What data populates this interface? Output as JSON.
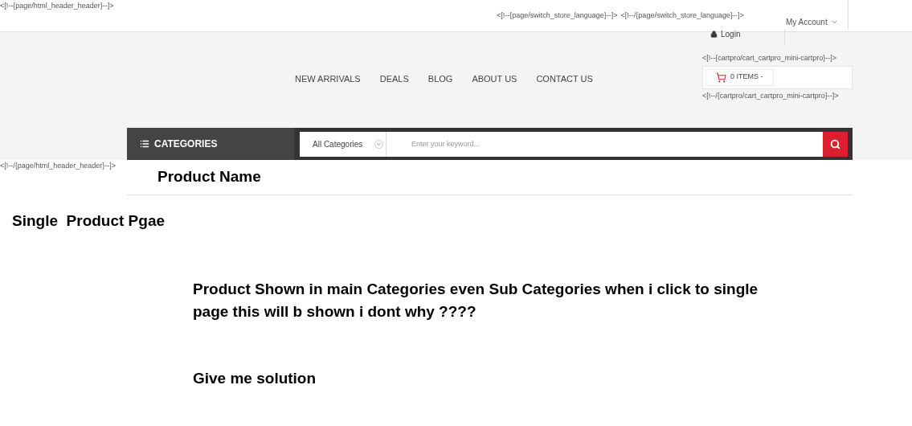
{
  "header_comment_open": "<[!--{page/html_header_header}--]>",
  "language_comments": [
    "<[!--{page/switch_store_language}--]>",
    "<[!--/{page/switch_store_language}--]>"
  ],
  "account_menu": {
    "label": "My Account"
  },
  "login": {
    "label": "Login"
  },
  "nav": [
    "NEW ARRIVALS",
    "DEALS",
    "BLOG",
    "ABOUT US",
    "CONTACT US"
  ],
  "cart": {
    "comment_open": "<[!--{cartpro/cart_cartpro_mini-cartpro}--]>",
    "label": "0 ITEMS -",
    "comment_close": "<[!--/{cartpro/cart_cartpro_mini-cartpro}--]>"
  },
  "categories_button": {
    "label": "CATEGORIES"
  },
  "search": {
    "category": "All Categories",
    "placeholder": "Enter your keyword..."
  },
  "header_comment_close": "<[!--/{page/html_header_header}--]>",
  "product_title": "Product Name",
  "page_note": "Single  Product Pgae",
  "question": "Product Shown in main Categories even Sub Categories when i click to single page this will b shown i dont why ????",
  "request": "Give me solution"
}
